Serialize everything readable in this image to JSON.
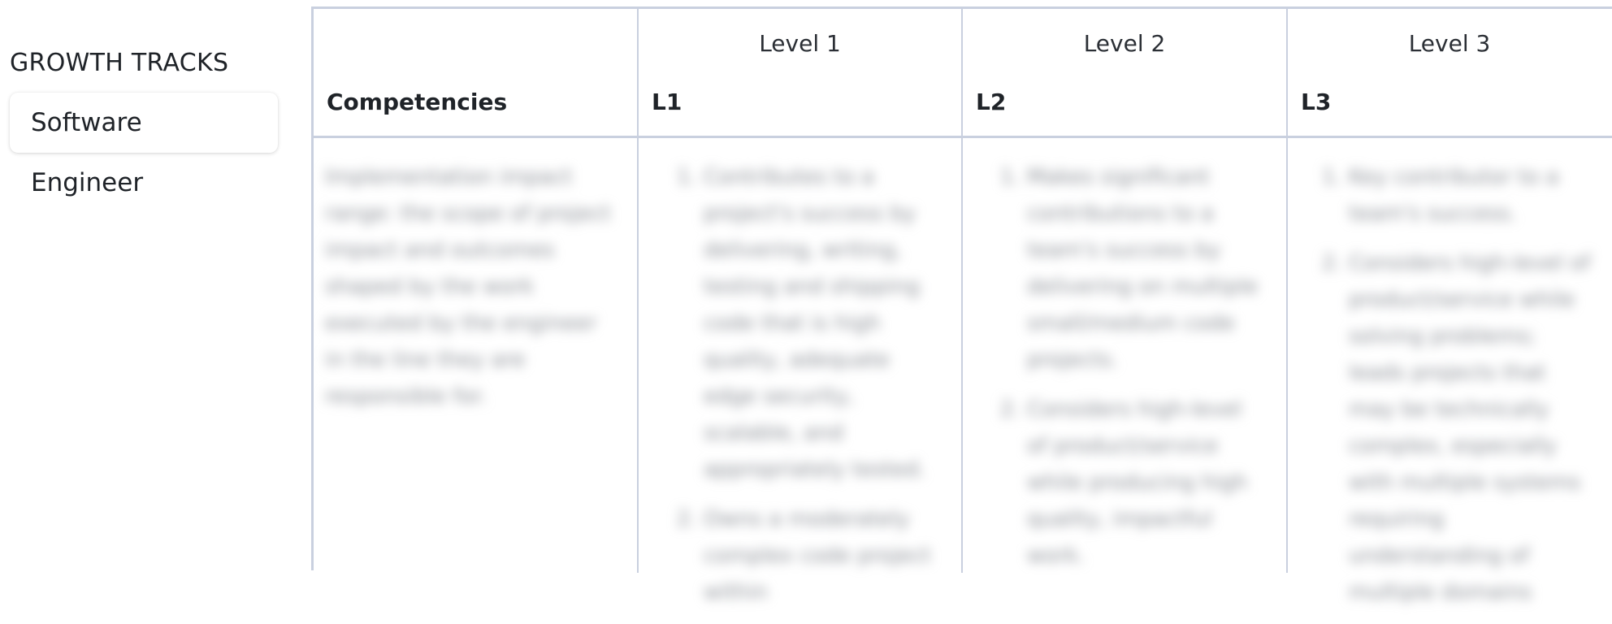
{
  "sidebar": {
    "title": "GROWTH TRACKS",
    "track": "Software Engineer"
  },
  "table": {
    "competencies_header": "Competencies",
    "levels": [
      {
        "name": "Level 1",
        "code": "L1"
      },
      {
        "name": "Level 2",
        "code": "L2"
      },
      {
        "name": "Level 3",
        "code": "L3"
      }
    ],
    "competency_description": "Implementation impact range: the scope of project impact and outcomes shaped by the work executed by the engineer in the line they are responsible for.",
    "level_items": [
      [
        "Contributes to a project's success by delivering, writing, testing and shipping code that is high quality, adequate edge security, scalable, and appropriately tested.",
        "Owns a moderately complex code project within"
      ],
      [
        "Makes significant contributions to a team's success by delivering on multiple small/medium code projects.",
        "Considers high-level of product/service while producing high quality, impactful work."
      ],
      [
        "Key contributor to a team's success.",
        "Considers high-level of product/service while solving problems; leads projects that may be technically complex, especially with multiple systems requiring understanding of multiple domains"
      ]
    ]
  }
}
